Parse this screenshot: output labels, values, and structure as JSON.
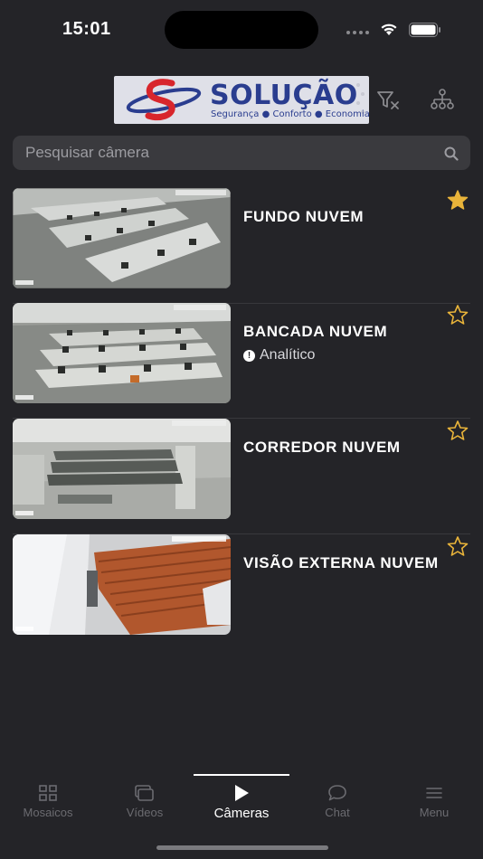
{
  "status": {
    "time": "15:01"
  },
  "header": {
    "logo_title": "SOLUÇÃO",
    "logo_subtitle": "Segurança ● Conforto ● Economia"
  },
  "search": {
    "placeholder": "Pesquisar câmera"
  },
  "cameras": [
    {
      "name": "FUNDO NUVEM",
      "subtitle": "",
      "favorite": true,
      "timestamp": "05/02/2024 14:01:05",
      "overlay": "Tecvoz"
    },
    {
      "name": "BANCADA NUVEM",
      "subtitle": "Analítico",
      "favorite": false,
      "timestamp": "05/02/2024 14:22:05",
      "overlay": "Tecvoz"
    },
    {
      "name": "CORREDOR NUVEM",
      "subtitle": "",
      "favorite": false,
      "timestamp": "05/02/2024 14:01:05",
      "overlay": "Tecvoz"
    },
    {
      "name": "VISÃO EXTERNA NUVEM",
      "subtitle": "",
      "favorite": false,
      "timestamp": "15/02/2024 14:22:57",
      "overlay": "Tecvoz"
    }
  ],
  "tabs": [
    {
      "label": "Mosaicos",
      "icon": "grid-icon",
      "active": false
    },
    {
      "label": "Vídeos",
      "icon": "videos-icon",
      "active": false
    },
    {
      "label": "Câmeras",
      "icon": "play-icon",
      "active": true
    },
    {
      "label": "Chat",
      "icon": "chat-icon",
      "active": false
    },
    {
      "label": "Menu",
      "icon": "menu-icon",
      "active": false
    }
  ],
  "colors": {
    "background": "#242428",
    "star": "#e9b43a",
    "search_bg": "#3a3a3e",
    "logo_blue": "#2a3d8f",
    "logo_red": "#d8262c"
  }
}
